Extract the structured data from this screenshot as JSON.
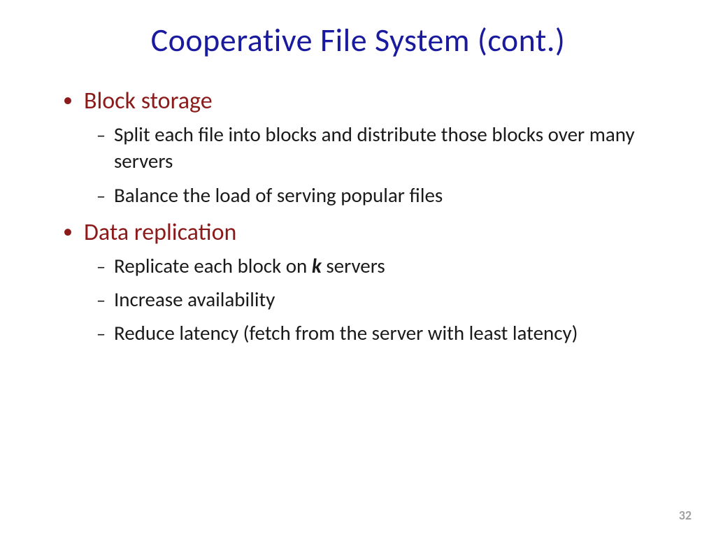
{
  "slide": {
    "title": "Cooperative File System (cont.)",
    "bullets": [
      {
        "label": "Block storage",
        "subs": [
          "Split each file into blocks and distribute those blocks over many servers",
          "Balance the load of serving popular files"
        ]
      },
      {
        "label": "Data replication",
        "subs_rich": [
          {
            "prefix": "Replicate each block on ",
            "emph": "k",
            "suffix": " servers"
          },
          {
            "prefix": "Increase availability",
            "emph": "",
            "suffix": ""
          },
          {
            "prefix": "Reduce latency (fetch from the server with least latency)",
            "emph": "",
            "suffix": ""
          }
        ]
      }
    ],
    "page_number": "32"
  }
}
